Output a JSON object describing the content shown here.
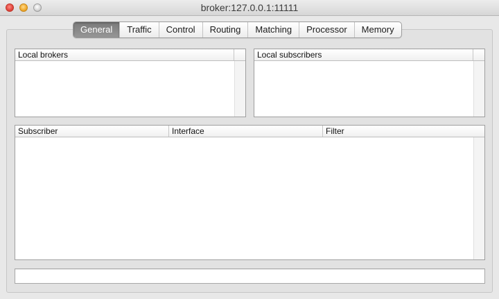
{
  "window": {
    "title": "broker:127.0.0.1:11111"
  },
  "tabs": [
    {
      "label": "General",
      "selected": true
    },
    {
      "label": "Traffic",
      "selected": false
    },
    {
      "label": "Control",
      "selected": false
    },
    {
      "label": "Routing",
      "selected": false
    },
    {
      "label": "Matching",
      "selected": false
    },
    {
      "label": "Processor",
      "selected": false
    },
    {
      "label": "Memory",
      "selected": false
    }
  ],
  "local_brokers": {
    "header": "Local brokers",
    "rows": []
  },
  "local_subscribers": {
    "header": "Local subscribers",
    "rows": []
  },
  "subscriptions": {
    "columns": [
      "Subscriber",
      "Interface",
      "Filter"
    ],
    "rows": []
  },
  "status_field": {
    "value": ""
  }
}
